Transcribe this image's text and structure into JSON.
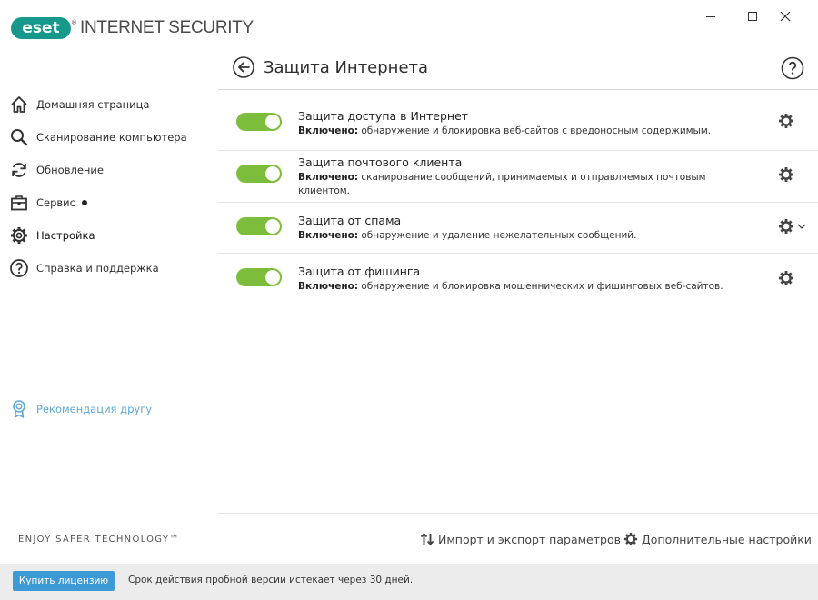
{
  "app": {
    "logo_badge": "eset",
    "logo_reg": "®",
    "product_name": "INTERNET SECURITY",
    "accent_color": "#16998a"
  },
  "window_controls": {
    "minimize_icon": "minimize-icon",
    "maximize_icon": "maximize-icon",
    "close_label": "✕"
  },
  "sidebar": {
    "items": [
      {
        "label": "Домашняя страница",
        "icon": "home-icon"
      },
      {
        "label": "Сканирование компьютера",
        "icon": "search-icon"
      },
      {
        "label": "Обновление",
        "icon": "refresh-icon"
      },
      {
        "label": "Сервис",
        "icon": "briefcase-icon",
        "has_dot": true
      },
      {
        "label": "Настройка",
        "icon": "gear-icon",
        "active": true
      },
      {
        "label": "Справка и поддержка",
        "icon": "help-icon"
      }
    ],
    "recommend_label": "Рекомендация другу",
    "recommend_color": "#5fa8d3",
    "tagline": "ENJOY SAFER TECHNOLOGY™"
  },
  "main": {
    "title": "Защита Интернета",
    "rows": [
      {
        "title": "Защита доступа в Интернет",
        "status": "Включено:",
        "desc": " обнаружение и блокировка веб-сайтов с вредоносным содержимым.",
        "enabled": true
      },
      {
        "title": "Защита почтового клиента",
        "status": "Включено:",
        "desc": " сканирование сообщений, принимаемых и отправляемых почтовым клиентом.",
        "enabled": true
      },
      {
        "title": "Защита от спама",
        "status": "Включено:",
        "desc": " обнаружение и удаление нежелательных сообщений.",
        "enabled": true
      },
      {
        "title": "Защита от фишинга",
        "status": "Включено:",
        "desc": " обнаружение и блокировка мошеннических и фишинговых веб-сайтов.",
        "enabled": true
      }
    ],
    "toggle_color": "#7cbd3c",
    "import_export_label": "Импорт и экспорт параметров",
    "advanced_label": "Дополнительные настройки"
  },
  "footer": {
    "buy_label": "Купить лицензию",
    "trial_text": "Срок действия пробной версии истекает через 30 дней."
  }
}
